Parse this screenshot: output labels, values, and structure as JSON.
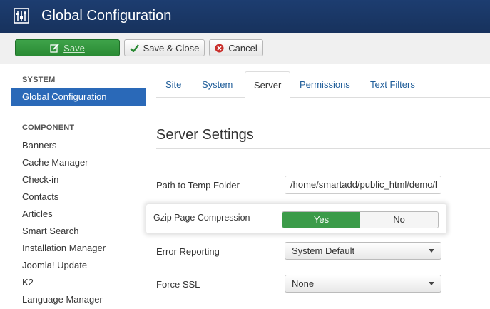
{
  "header": {
    "title": "Global Configuration",
    "logo_icon": "sliders-icon"
  },
  "toolbar": {
    "save_label": "Save",
    "save_close_label": "Save & Close",
    "cancel_label": "Cancel"
  },
  "sidebar": {
    "system_heading": "SYSTEM",
    "active_item": "Global Configuration",
    "component_heading": "COMPONENT",
    "items": [
      "Banners",
      "Cache Manager",
      "Check-in",
      "Contacts",
      "Articles",
      "Smart Search",
      "Installation Manager",
      "Joomla! Update",
      "K2",
      "Language Manager"
    ]
  },
  "tabs": [
    "Site",
    "System",
    "Server",
    "Permissions",
    "Text Filters"
  ],
  "active_tab": "Server",
  "section_title": "Server Settings",
  "fields": {
    "temp_label": "Path to Temp Folder",
    "temp_value": "/home/smartadd/public_html/demo/l",
    "gzip_label": "Gzip Page Compression",
    "gzip_yes": "Yes",
    "gzip_no": "No",
    "error_label": "Error Reporting",
    "error_value": "System Default",
    "ssl_label": "Force SSL",
    "ssl_value": "None"
  },
  "colors": {
    "header_bg": "#1a3867",
    "save_green": "#2a8a34",
    "active_blue": "#2a69b8",
    "toggle_yes": "#3b9b49",
    "link_blue": "#1f5d99"
  }
}
